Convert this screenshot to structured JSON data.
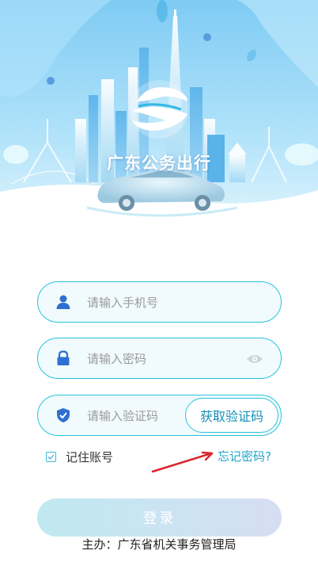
{
  "header": {
    "app_title": "广东公务出行"
  },
  "form": {
    "phone": {
      "placeholder": "请输入手机号",
      "value": ""
    },
    "password": {
      "placeholder": "请输入密码",
      "value": ""
    },
    "code": {
      "placeholder": "请输入验证码",
      "value": ""
    },
    "get_code_label": "获取验证码",
    "remember_label": "记住账号",
    "remember_checked": true,
    "forgot_label": "忘记密码?",
    "login_label": "登录"
  },
  "footer": {
    "organizer_text": "主办：广东省机关事务管理局"
  },
  "icons": {
    "user": "user-icon",
    "lock": "lock-icon",
    "shield": "shield-check-icon",
    "eye": "eye-icon",
    "logo": "app-logo"
  },
  "colors": {
    "accent": "#27c3dd",
    "link": "#1fa6c9",
    "field_bg": "#f1fbfd",
    "header_sky": "#8fd3f6",
    "arrow": "#d9252a"
  }
}
